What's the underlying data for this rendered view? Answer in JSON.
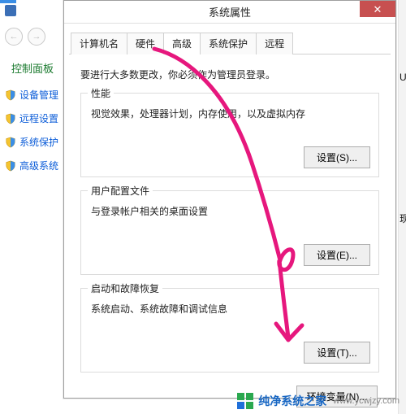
{
  "bg": {
    "breadcrumb": "控制面板",
    "side_items": [
      "设备管理",
      "远程设置",
      "系统保护",
      "高级系统"
    ]
  },
  "dialog": {
    "title": "系统属性",
    "tabs": [
      "计算机名",
      "硬件",
      "高级",
      "系统保护",
      "远程"
    ],
    "active_tab": 2,
    "admin_note": "要进行大多数更改，你必须作为管理员登录。",
    "groups": [
      {
        "legend": "性能",
        "desc": "视觉效果，处理器计划，内存使用，以及虚拟内存",
        "button": "设置(S)..."
      },
      {
        "legend": "用户配置文件",
        "desc": "与登录帐户相关的桌面设置",
        "button": "设置(E)..."
      },
      {
        "legend": "启动和故障恢复",
        "desc": "系统启动、系统故障和调试信息",
        "button": "设置(T)..."
      }
    ],
    "env_button": "环境变量(N)..."
  },
  "watermark": {
    "brand": "纯净系统之家",
    "url": "www.ycwjzy.com"
  }
}
